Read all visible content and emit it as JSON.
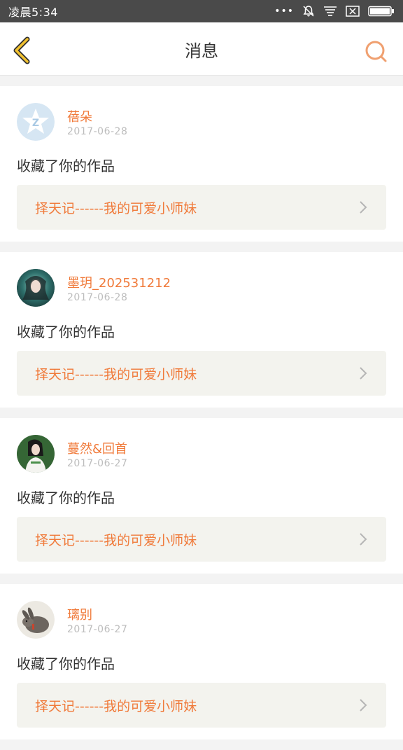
{
  "status_bar": {
    "time": "凌晨5:34",
    "dots": "•••",
    "icons": [
      "bell-muted-icon",
      "notification-lines-icon",
      "screenshot-close-icon",
      "battery-icon"
    ],
    "background": "#4a4a4a"
  },
  "header": {
    "title": "消息",
    "back_icon": "chevron-left-icon",
    "search_icon": "search-icon",
    "accent_back": "#f2c230",
    "accent_search": "#f0a070"
  },
  "messages": [
    {
      "username": "蓓朵",
      "date": "2017-06-28",
      "action": "收藏了你的作品",
      "work_title": "择天记------我的可爱小师妹",
      "avatar": "qq-default-avatar"
    },
    {
      "username": "墨玥_202531212",
      "date": "2017-06-28",
      "action": "收藏了你的作品",
      "work_title": "择天记------我的可爱小师妹",
      "avatar": "photo-avatar-girl-teal"
    },
    {
      "username": "蔓然&回首",
      "date": "2017-06-27",
      "action": "收藏了你的作品",
      "work_title": "择天记------我的可爱小师妹",
      "avatar": "photo-avatar-girl-green"
    },
    {
      "username": "璃别",
      "date": "2017-06-27",
      "action": "收藏了你的作品",
      "work_title": "择天记------我的可爱小师妹",
      "avatar": "photo-avatar-rabbit"
    }
  ],
  "colors": {
    "username": "#f07a3a",
    "date": "#bdbdbd",
    "work_link_bg": "#f3f3ee"
  }
}
